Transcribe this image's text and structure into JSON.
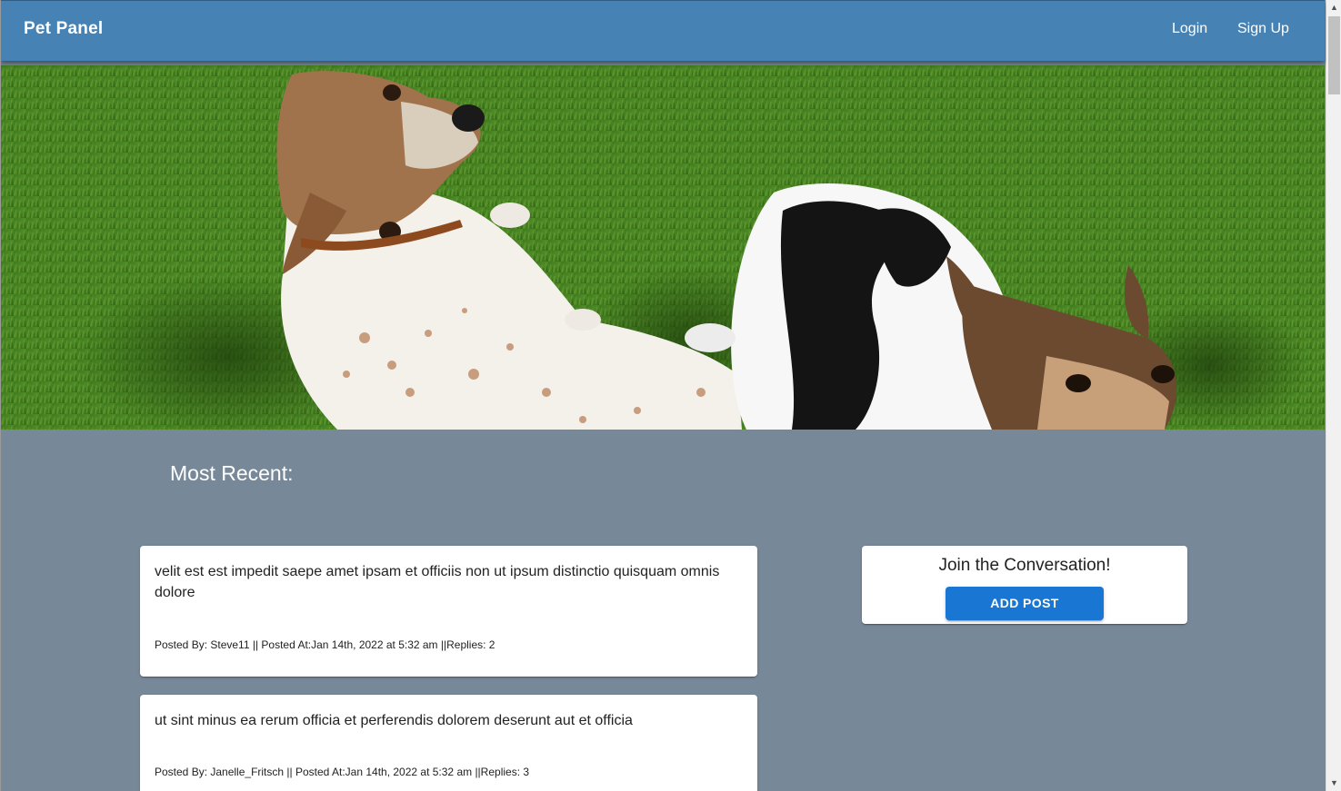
{
  "app": {
    "brand": "Pet Panel",
    "nav": {
      "login": "Login",
      "signup": "Sign Up"
    }
  },
  "hero": {
    "alt": "two dogs lying on grass"
  },
  "main": {
    "section_title": "Most Recent:",
    "posts": [
      {
        "body": "velit est est impedit saepe amet ipsam et officiis non ut ipsum distinctio quisquam omnis dolore",
        "meta": "Posted By: Steve11 || Posted At:Jan 14th, 2022 at 5:32 am ||Replies: 2"
      },
      {
        "body": "ut sint minus ea rerum officia et perferendis dolorem deserunt aut et officia",
        "meta": "Posted By: Janelle_Fritsch || Posted At:Jan 14th, 2022 at 5:32 am ||Replies: 3"
      }
    ]
  },
  "sidebar": {
    "join_title": "Join the Conversation!",
    "add_post_label": "ADD POST"
  },
  "colors": {
    "appbar": "#4682b4",
    "background": "#778899",
    "button": "#1976d2"
  }
}
